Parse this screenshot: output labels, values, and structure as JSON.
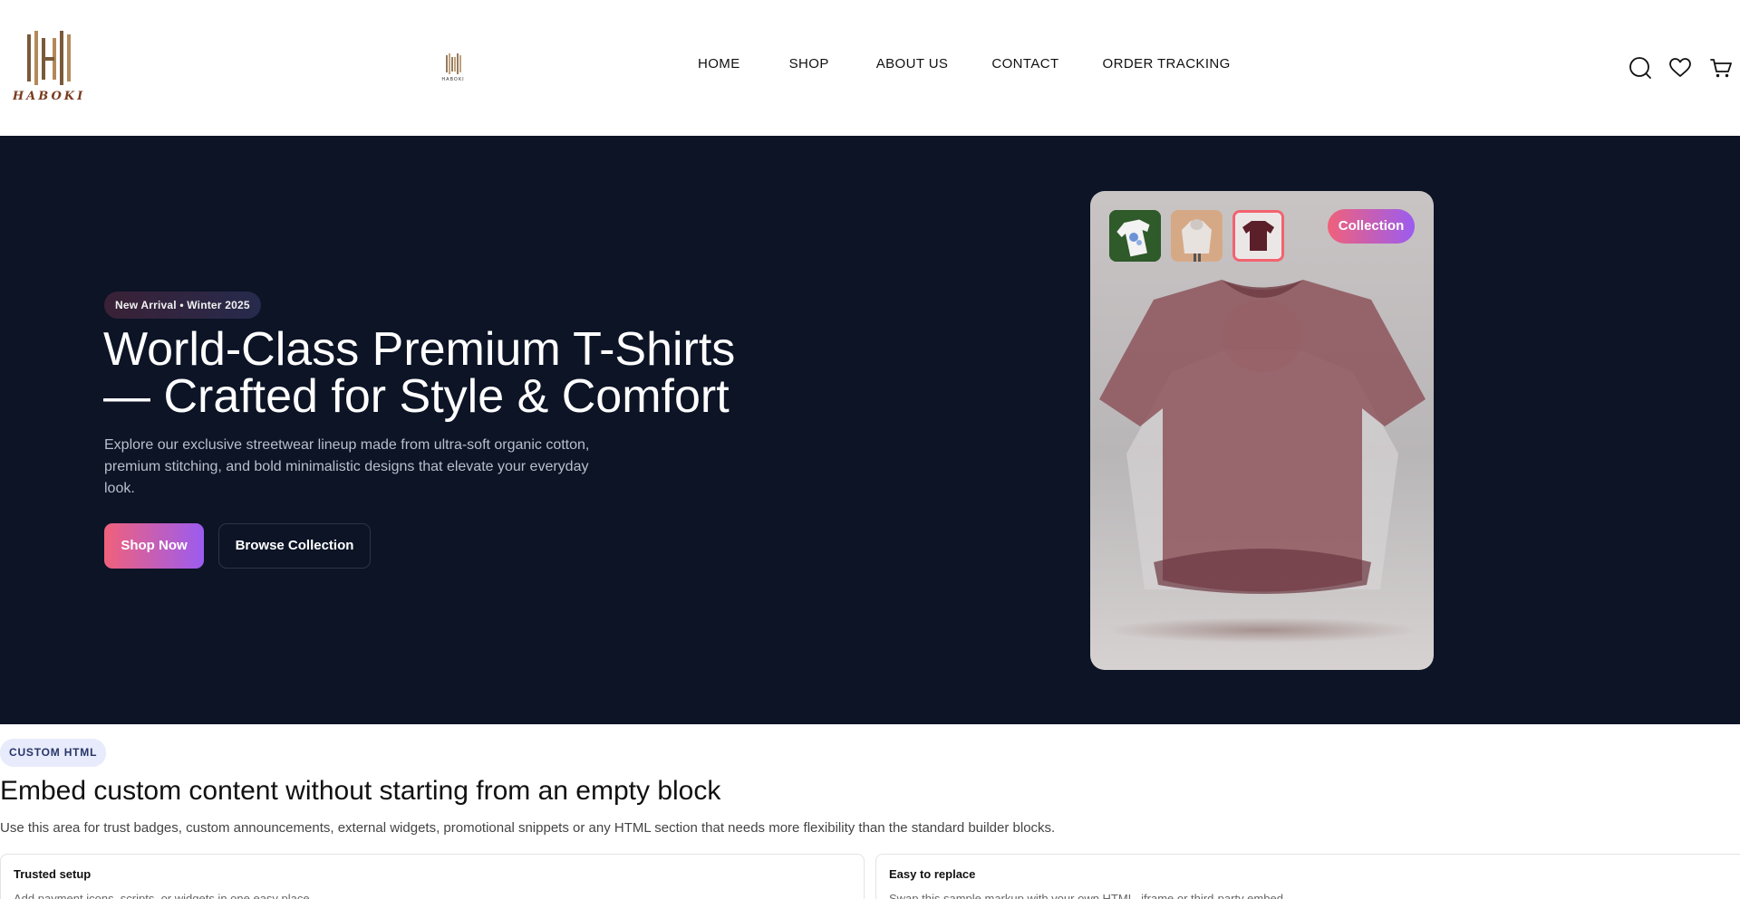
{
  "header": {
    "logo_text": "HABOKI",
    "nav": [
      "HOME",
      "SHOP",
      "ABOUT US",
      "CONTACT",
      "ORDER TRACKING"
    ],
    "icons": [
      "search-icon",
      "heart-icon",
      "cart-icon"
    ]
  },
  "hero": {
    "badge": "New Arrival • Winter 2025",
    "title": "World-Class Premium T-Shirts — Crafted for Style & Comfort",
    "description": "Explore our exclusive streetwear lineup made from ultra-soft organic cotton, premium stitching, and bold minimalistic designs that elevate your everyday look.",
    "primary_button": "Shop Now",
    "secondary_button": "Browse Collection",
    "collection_badge": "Collection"
  },
  "custom_section": {
    "tag": "CUSTOM HTML",
    "title": "Embed custom content without starting from an empty block",
    "description": "Use this area for trust badges, custom announcements, external widgets, promotional snippets or any HTML section that needs more flexibility than the standard builder blocks.",
    "features": [
      {
        "title": "Trusted setup",
        "text": "Add payment icons, scripts, or widgets in one easy place."
      },
      {
        "title": "Easy to replace",
        "text": "Swap this sample markup with your own HTML, iframe or third-party embed."
      }
    ]
  },
  "colors": {
    "hero_bg": "#0c1426",
    "accent_from": "#f0617a",
    "accent_to": "#9b5cf0",
    "logo_gold": "#b28a5a"
  }
}
